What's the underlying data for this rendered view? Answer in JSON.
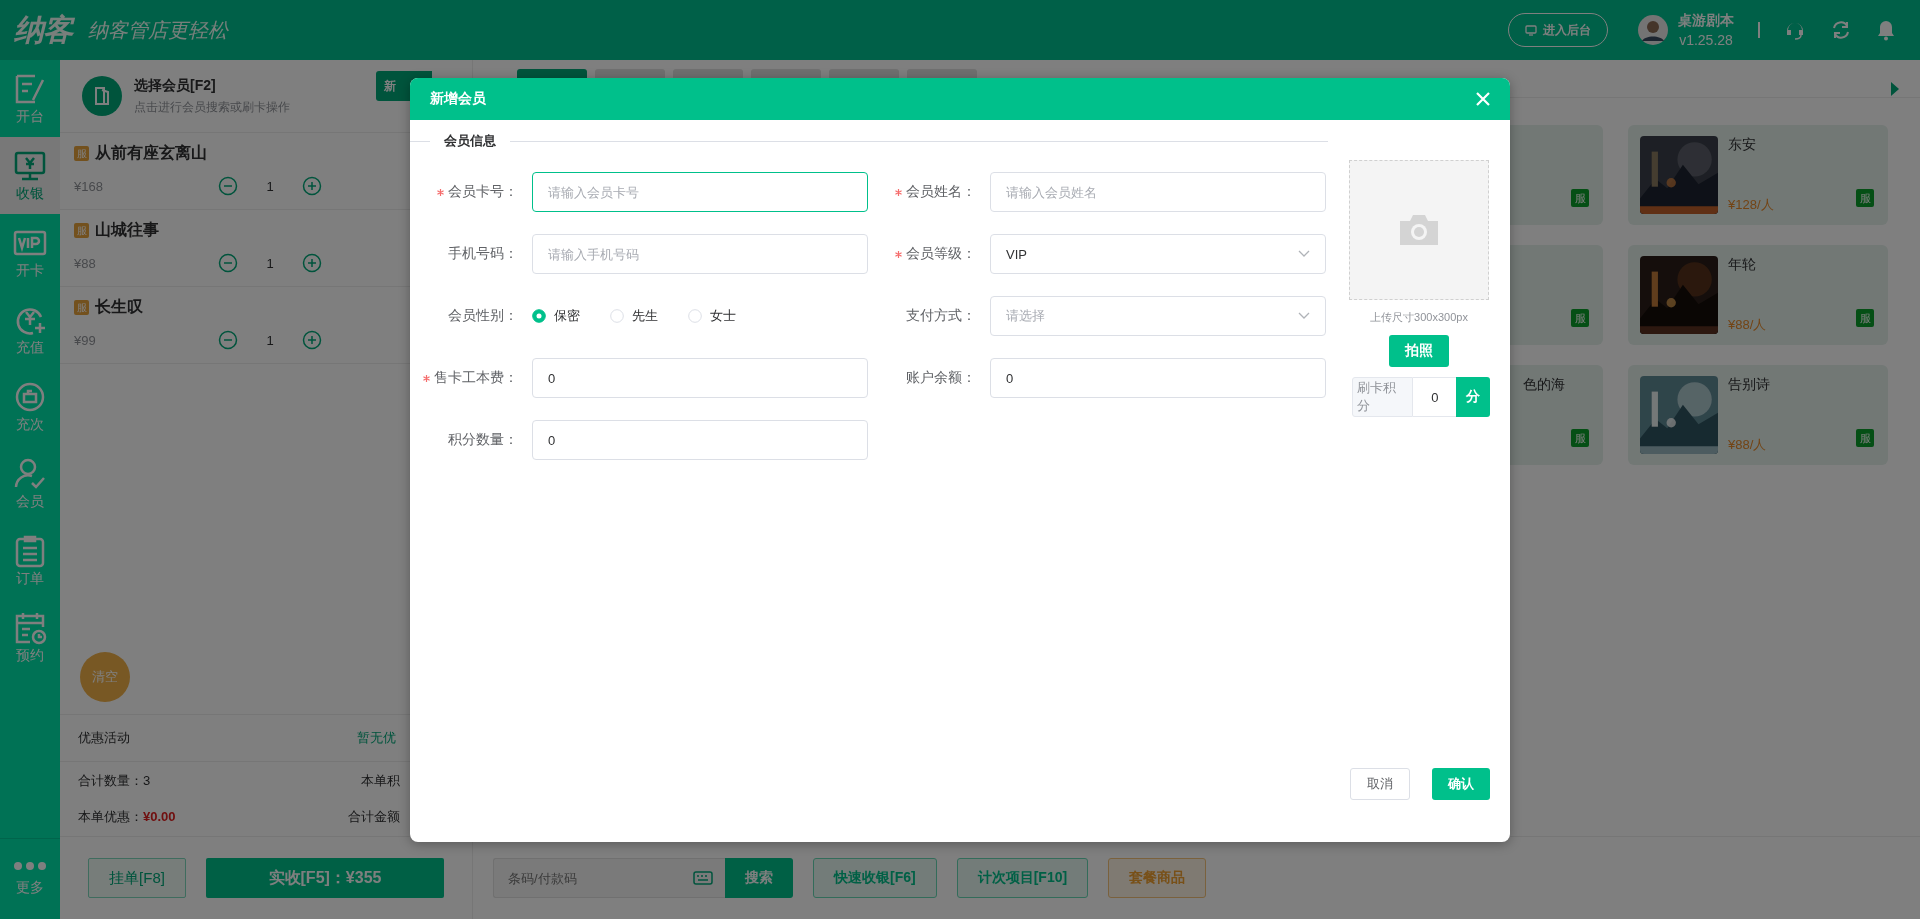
{
  "topbar": {
    "logo": "纳客",
    "slogan": "纳客管店更轻松",
    "admin_button": "进入后台",
    "user": {
      "name": "桌游剧本",
      "version": "v1.25.28"
    }
  },
  "nav": {
    "items": [
      {
        "label": "开台",
        "selected": false
      },
      {
        "label": "收银",
        "selected": true
      },
      {
        "label": "开卡",
        "selected": false
      },
      {
        "label": "充值",
        "selected": false
      },
      {
        "label": "充次",
        "selected": false
      },
      {
        "label": "会员",
        "selected": false
      },
      {
        "label": "订单",
        "selected": false
      },
      {
        "label": "预约",
        "selected": false
      }
    ],
    "more": "更多"
  },
  "cart": {
    "member": {
      "title": "选择会员[F2]",
      "hint": "点击进行会员搜索或刷卡操作"
    },
    "new_button": "新",
    "items": [
      {
        "badge": "服",
        "name": "从前有座玄离山",
        "price": "¥168",
        "qty": "1"
      },
      {
        "badge": "服",
        "name": "山城往事",
        "price": "¥88",
        "qty": "1"
      },
      {
        "badge": "服",
        "name": "长生叹",
        "price": "¥99",
        "qty": "1"
      }
    ],
    "clear_button": "清空",
    "promo": {
      "label": "优惠活动",
      "value": "暂无优"
    },
    "total_qty": "合计数量：3",
    "points": "本单积",
    "discount": {
      "label": "本单优惠：",
      "value": "¥0.00"
    },
    "amount": "合计金额",
    "hold_button": "挂单[F8]",
    "pay_button": "实收[F5]：¥355"
  },
  "tabs": [
    {
      "selected": true
    },
    {
      "selected": false
    },
    {
      "selected": false
    },
    {
      "selected": false
    },
    {
      "selected": false
    },
    {
      "selected": false
    }
  ],
  "product_rows": [
    {
      "items": [
        {
          "badge": "服"
        },
        {
          "name": "东安",
          "price": "¥128/人",
          "badge": "服",
          "kind": "picture"
        }
      ]
    },
    {
      "items": [
        {
          "badge": "服"
        },
        {
          "name": "年轮",
          "price": "¥88/人",
          "badge": "服",
          "kind": "picture"
        }
      ]
    },
    {
      "items": [
        {
          "name": "色的海",
          "badge": "服"
        },
        {
          "name": "告别诗",
          "price": "¥88/人",
          "badge": "服",
          "kind": "picture"
        }
      ]
    }
  ],
  "search": {
    "placeholder": "条码/付款码",
    "button": "搜索"
  },
  "quick_buttons": [
    {
      "label": "快速收银[F6]",
      "kind": "normal"
    },
    {
      "label": "计次项目[F10]",
      "kind": "normal"
    },
    {
      "label": "套餐商品",
      "kind": "package"
    }
  ],
  "modal": {
    "title": "新增会员",
    "section": "会员信息",
    "fields": [
      {
        "label": "会员卡号：",
        "required": true,
        "kind": "text",
        "placeholder": "请输入会员卡号",
        "focused": true
      },
      {
        "label": "会员姓名：",
        "required": true,
        "kind": "text",
        "placeholder": "请输入会员姓名",
        "focused": false
      },
      {
        "label": "手机号码：",
        "required": false,
        "kind": "text",
        "placeholder": "请输入手机号码",
        "focused": false
      },
      {
        "label": "会员等级：",
        "required": true,
        "kind": "select",
        "value": "VIP"
      },
      {
        "label": "会员性别：",
        "required": false,
        "kind": "radio",
        "options": [
          {
            "label": "保密",
            "selected": true
          },
          {
            "label": "先生",
            "selected": false
          },
          {
            "label": "女士",
            "selected": false
          }
        ]
      },
      {
        "label": "支付方式：",
        "required": false,
        "kind": "select",
        "placeholder": "请选择"
      },
      {
        "label": "售卡工本费：",
        "required": true,
        "kind": "text",
        "value": "0",
        "focused": false
      },
      {
        "label": "账户余额：",
        "required": false,
        "kind": "text",
        "value": "0",
        "focused": false
      },
      {
        "label": "积分数量：",
        "required": false,
        "kind": "text",
        "value": "0",
        "focused": false
      }
    ],
    "upload_hint": "上传尺寸300x300px",
    "photo_button": "拍照",
    "card_points": {
      "label": "刷卡积分",
      "value": "0",
      "unit": "分"
    },
    "cancel_button": "取消",
    "confirm_button": "确认"
  }
}
